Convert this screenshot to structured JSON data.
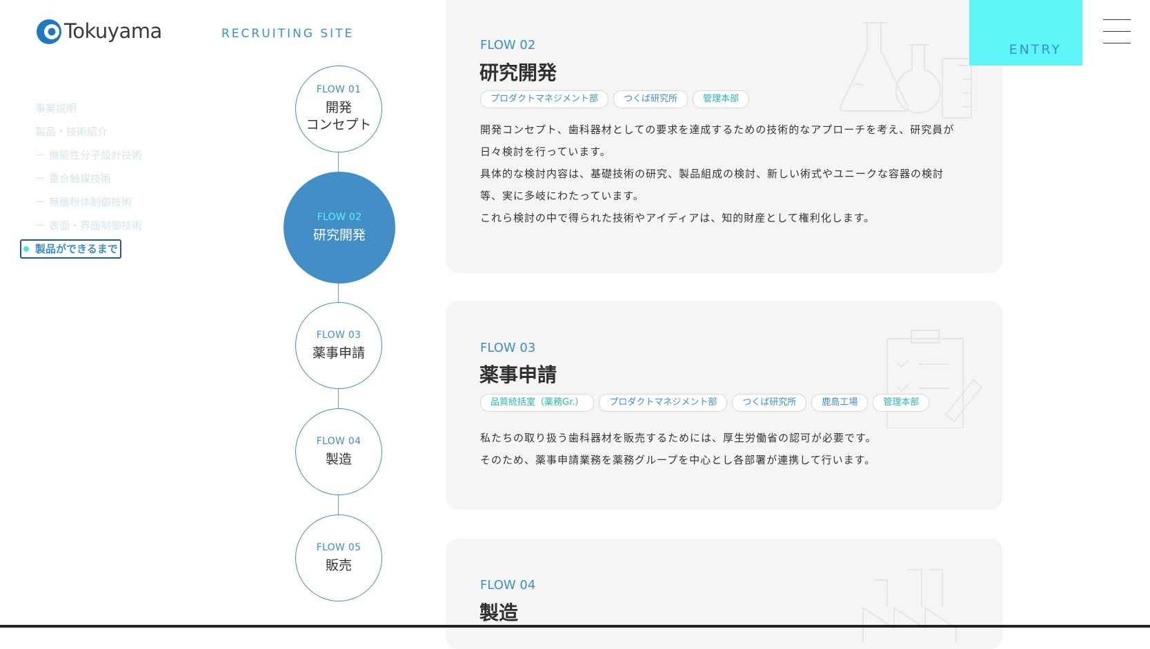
{
  "header": {
    "brand": "Tokuyama",
    "site_label": "RECRUITING SITE",
    "entry_label": "ENTRY"
  },
  "side_nav": {
    "items": [
      {
        "label": "事業説明"
      },
      {
        "label": "製品・技術紹介"
      },
      {
        "label": "機能性分子設計技術"
      },
      {
        "label": "重合触媒技術"
      },
      {
        "label": "無機粉体制御技術"
      },
      {
        "label": "表面・界面制御技術"
      },
      {
        "label": "製品ができるまで"
      }
    ]
  },
  "flow_nodes": [
    {
      "num": "FLOW 01",
      "title_line1": "開発",
      "title_line2": "コンセプト"
    },
    {
      "num": "FLOW 02",
      "title": "研究開発"
    },
    {
      "num": "FLOW 03",
      "title": "薬事申請"
    },
    {
      "num": "FLOW 04",
      "title": "製造"
    },
    {
      "num": "FLOW 05",
      "title": "販売"
    }
  ],
  "cards": [
    {
      "num": "FLOW 02",
      "title": "研究開発",
      "tags": [
        "プロダクトマネジメント部",
        "つくば研究所",
        "管理本部"
      ],
      "body": [
        "開発コンセプト、歯科器材としての要求を達成するための技術的なアプローチを考え、研究員が",
        "日々検討を行っています。",
        "具体的な検討内容は、基礎技術の研究、製品組成の検討、新しい術式やユニークな容器の検討",
        "等、実に多岐にわたっています。",
        "これら検討の中で得られた技術やアイディアは、知的財産として権利化します。"
      ]
    },
    {
      "num": "FLOW 03",
      "title": "薬事申請",
      "tags": [
        "品質統括室（薬務Gr.）",
        "プロダクトマネジメント部",
        "つくば研究所",
        "鹿島工場",
        "管理本部"
      ],
      "body": [
        "私たちの取り扱う歯科器材を販売するためには、厚生労働省の認可が必要です。",
        "そのため、薬事申請業務を薬務グループを中心とし各部署が連携して行います。"
      ]
    },
    {
      "num": "FLOW 04",
      "title": "製造"
    }
  ],
  "colors": {
    "accent_blue": "#418fc6",
    "accent_cyan": "#5ef5f9",
    "tag_teal": "#26b6b8",
    "card_bg": "#f5f5f5"
  },
  "icons": [
    "tokuyama-logo-icon",
    "flask-icon",
    "clipboard-icon",
    "factory-icon",
    "hamburger-menu-icon"
  ]
}
